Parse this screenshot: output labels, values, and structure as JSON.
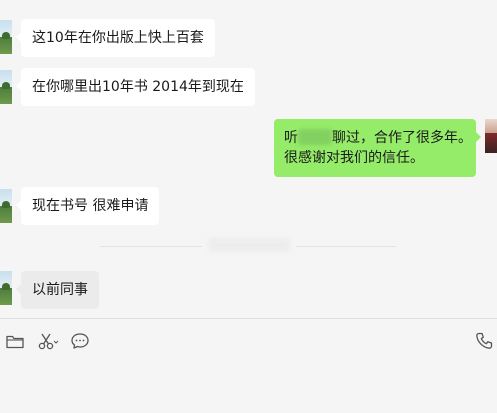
{
  "messages": [
    {
      "side": "left",
      "text": "这10年在你出版上快上百套"
    },
    {
      "side": "left",
      "text": "在你哪里出10年书 2014年到现在"
    },
    {
      "side": "right",
      "line1_start": "听",
      "line1_end": "聊过，合作了很多年。",
      "line2": "很感谢对我们的信任。"
    },
    {
      "side": "left",
      "text": "现在书号 很难申请"
    },
    {
      "side": "left",
      "text": "以前同事"
    }
  ],
  "colors": {
    "sent_bubble": "#95ec69",
    "received_bubble": "#ffffff",
    "background": "#f5f5f5"
  },
  "toolbar": {
    "icons": [
      "folder-icon",
      "scissors-icon",
      "chat-bubble-icon",
      "phone-icon"
    ]
  }
}
